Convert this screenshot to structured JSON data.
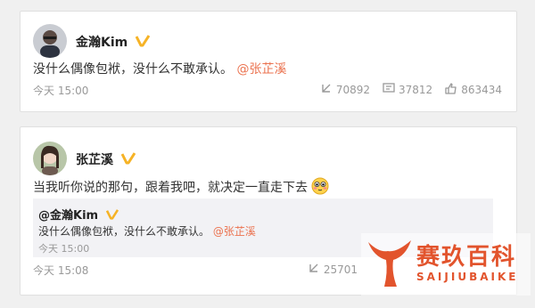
{
  "post1": {
    "username": "金瀚Kim",
    "text": "没什么偶像包袱，没什么不敢承认。",
    "mention": "@张芷溪",
    "time": "今天 15:00",
    "reposts": "70892",
    "comments": "37812",
    "likes": "863434"
  },
  "post2": {
    "username": "张芷溪",
    "text": "当我听你说的那句，跟着我吧，就决定一直走下去",
    "emoji_icon": "blushing-face-icon",
    "quoted": {
      "username": "@金瀚Kim",
      "text": "没什么偶像包袱，没什么不敢承认。",
      "mention": "@张芷溪",
      "time": "今天 15:00"
    },
    "time": "今天 15:08",
    "reposts": "25701"
  },
  "watermark": {
    "brand": "赛玖百科",
    "brand_latin": "SAIJIUBAIKE",
    "color": "#e2542d"
  },
  "colors": {
    "mention": "#eb7350",
    "verified": "#f6b326",
    "muted": "#999999"
  }
}
